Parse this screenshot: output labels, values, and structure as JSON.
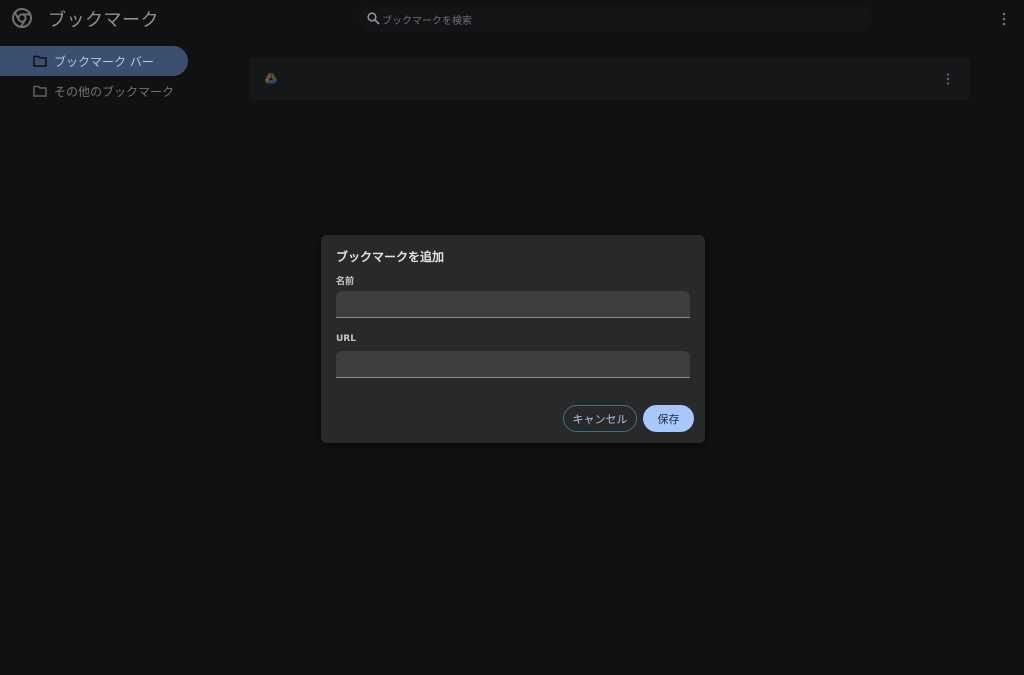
{
  "header": {
    "title": "ブックマーク",
    "search_placeholder": "ブックマークを検索",
    "icons": {
      "logo": "chrome-logo-icon",
      "search": "search-icon",
      "menu": "more-vert-icon"
    }
  },
  "sidebar": {
    "items": [
      {
        "label": "ブックマーク バー",
        "selected": true,
        "icon": "folder-icon"
      },
      {
        "label": "その他のブックマーク",
        "selected": false,
        "icon": "folder-icon"
      }
    ]
  },
  "bookmark_list": {
    "items": [
      {
        "icon": "google-drive-icon",
        "menu_icon": "more-vert-icon"
      }
    ]
  },
  "dialog": {
    "title": "ブックマークを追加",
    "name_label": "名前",
    "name_value": "",
    "url_label": "URL",
    "url_value": "",
    "cancel_label": "キャンセル",
    "save_label": "保存"
  },
  "colors": {
    "background": "#111112",
    "selected_nav": "#3c4f6e",
    "dialog_bg": "#28292b",
    "primary_button": "#a8c7fa"
  }
}
